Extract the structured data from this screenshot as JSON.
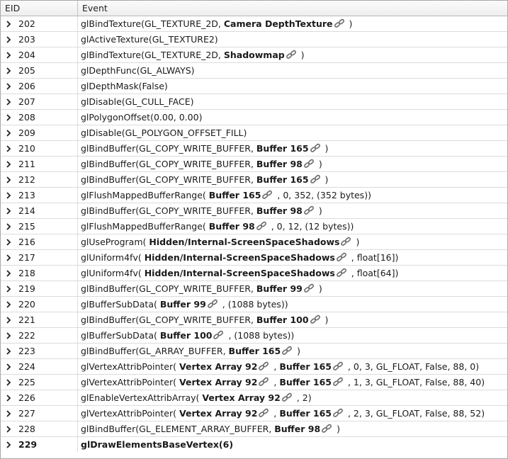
{
  "columns": {
    "eid": "EID",
    "event": "Event"
  },
  "link_icon": "chain-link-icon",
  "rows": [
    {
      "eid": "202",
      "parts": [
        {
          "t": "glBindTexture(GL_TEXTURE_2D, "
        },
        {
          "t": "Camera DepthTexture",
          "r": true
        },
        {
          "t": " )"
        }
      ]
    },
    {
      "eid": "203",
      "parts": [
        {
          "t": "glActiveTexture(GL_TEXTURE2)"
        }
      ]
    },
    {
      "eid": "204",
      "parts": [
        {
          "t": "glBindTexture(GL_TEXTURE_2D, "
        },
        {
          "t": "Shadowmap",
          "r": true
        },
        {
          "t": " )"
        }
      ]
    },
    {
      "eid": "205",
      "parts": [
        {
          "t": "glDepthFunc(GL_ALWAYS)"
        }
      ]
    },
    {
      "eid": "206",
      "parts": [
        {
          "t": "glDepthMask(False)"
        }
      ]
    },
    {
      "eid": "207",
      "parts": [
        {
          "t": "glDisable(GL_CULL_FACE)"
        }
      ]
    },
    {
      "eid": "208",
      "parts": [
        {
          "t": "glPolygonOffset(0.00, 0.00)"
        }
      ]
    },
    {
      "eid": "209",
      "parts": [
        {
          "t": "glDisable(GL_POLYGON_OFFSET_FILL)"
        }
      ]
    },
    {
      "eid": "210",
      "parts": [
        {
          "t": "glBindBuffer(GL_COPY_WRITE_BUFFER, "
        },
        {
          "t": "Buffer 165",
          "r": true
        },
        {
          "t": " )"
        }
      ]
    },
    {
      "eid": "211",
      "parts": [
        {
          "t": "glBindBuffer(GL_COPY_WRITE_BUFFER, "
        },
        {
          "t": "Buffer 98",
          "r": true
        },
        {
          "t": " )"
        }
      ]
    },
    {
      "eid": "212",
      "parts": [
        {
          "t": "glBindBuffer(GL_COPY_WRITE_BUFFER, "
        },
        {
          "t": "Buffer 165",
          "r": true
        },
        {
          "t": " )"
        }
      ]
    },
    {
      "eid": "213",
      "parts": [
        {
          "t": "glFlushMappedBufferRange( "
        },
        {
          "t": "Buffer 165",
          "r": true
        },
        {
          "t": " , 0, 352, (352 bytes))"
        }
      ]
    },
    {
      "eid": "214",
      "parts": [
        {
          "t": "glBindBuffer(GL_COPY_WRITE_BUFFER, "
        },
        {
          "t": "Buffer 98",
          "r": true
        },
        {
          "t": " )"
        }
      ]
    },
    {
      "eid": "215",
      "parts": [
        {
          "t": "glFlushMappedBufferRange( "
        },
        {
          "t": "Buffer 98",
          "r": true
        },
        {
          "t": " , 0, 12, (12 bytes))"
        }
      ]
    },
    {
      "eid": "216",
      "parts": [
        {
          "t": "glUseProgram( "
        },
        {
          "t": "Hidden/Internal-ScreenSpaceShadows",
          "r": true
        },
        {
          "t": " )"
        }
      ]
    },
    {
      "eid": "217",
      "parts": [
        {
          "t": "glUniform4fv( "
        },
        {
          "t": "Hidden/Internal-ScreenSpaceShadows",
          "r": true
        },
        {
          "t": " , float[16])"
        }
      ]
    },
    {
      "eid": "218",
      "parts": [
        {
          "t": "glUniform4fv( "
        },
        {
          "t": "Hidden/Internal-ScreenSpaceShadows",
          "r": true
        },
        {
          "t": " , float[64])"
        }
      ]
    },
    {
      "eid": "219",
      "parts": [
        {
          "t": "glBindBuffer(GL_COPY_WRITE_BUFFER, "
        },
        {
          "t": "Buffer 99",
          "r": true
        },
        {
          "t": " )"
        }
      ]
    },
    {
      "eid": "220",
      "parts": [
        {
          "t": "glBufferSubData( "
        },
        {
          "t": "Buffer 99",
          "r": true
        },
        {
          "t": " , (1088 bytes))"
        }
      ]
    },
    {
      "eid": "221",
      "parts": [
        {
          "t": "glBindBuffer(GL_COPY_WRITE_BUFFER, "
        },
        {
          "t": "Buffer 100",
          "r": true
        },
        {
          "t": " )"
        }
      ]
    },
    {
      "eid": "222",
      "parts": [
        {
          "t": "glBufferSubData( "
        },
        {
          "t": "Buffer 100",
          "r": true
        },
        {
          "t": " , (1088 bytes))"
        }
      ]
    },
    {
      "eid": "223",
      "parts": [
        {
          "t": "glBindBuffer(GL_ARRAY_BUFFER, "
        },
        {
          "t": "Buffer 165",
          "r": true
        },
        {
          "t": " )"
        }
      ]
    },
    {
      "eid": "224",
      "parts": [
        {
          "t": "glVertexAttribPointer( "
        },
        {
          "t": "Vertex Array 92",
          "r": true
        },
        {
          "t": " , "
        },
        {
          "t": "Buffer 165",
          "r": true
        },
        {
          "t": " , 0, 3, GL_FLOAT, False, 88, 0)"
        }
      ]
    },
    {
      "eid": "225",
      "parts": [
        {
          "t": "glVertexAttribPointer( "
        },
        {
          "t": "Vertex Array 92",
          "r": true
        },
        {
          "t": " , "
        },
        {
          "t": "Buffer 165",
          "r": true
        },
        {
          "t": " , 1, 3, GL_FLOAT, False, 88, 40)"
        }
      ]
    },
    {
      "eid": "226",
      "parts": [
        {
          "t": "glEnableVertexAttribArray( "
        },
        {
          "t": "Vertex Array 92",
          "r": true
        },
        {
          "t": " , 2)"
        }
      ]
    },
    {
      "eid": "227",
      "parts": [
        {
          "t": "glVertexAttribPointer( "
        },
        {
          "t": "Vertex Array 92",
          "r": true
        },
        {
          "t": " , "
        },
        {
          "t": "Buffer 165",
          "r": true
        },
        {
          "t": " , 2, 3, GL_FLOAT, False, 88, 52)"
        }
      ]
    },
    {
      "eid": "228",
      "parts": [
        {
          "t": "glBindBuffer(GL_ELEMENT_ARRAY_BUFFER, "
        },
        {
          "t": "Buffer 98",
          "r": true
        },
        {
          "t": " )"
        }
      ]
    },
    {
      "eid": "229",
      "bold": true,
      "parts": [
        {
          "t": "glDrawElementsBaseVertex(6)"
        }
      ]
    }
  ]
}
